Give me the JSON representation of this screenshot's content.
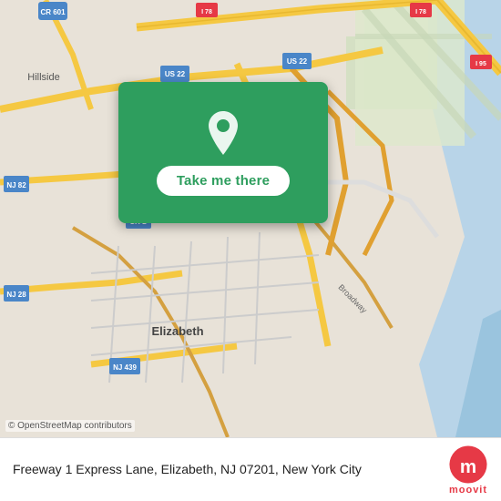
{
  "map": {
    "background_color": "#e8e2d8",
    "copyright": "© OpenStreetMap contributors"
  },
  "location_card": {
    "button_label": "Take me there",
    "pin_color": "white",
    "card_color": "#2e9e5e"
  },
  "info_bar": {
    "address": "Freeway 1 Express Lane, Elizabeth, NJ 07201, New York City"
  },
  "moovit": {
    "logo_text": "moovit",
    "logo_color": "#e63946"
  }
}
